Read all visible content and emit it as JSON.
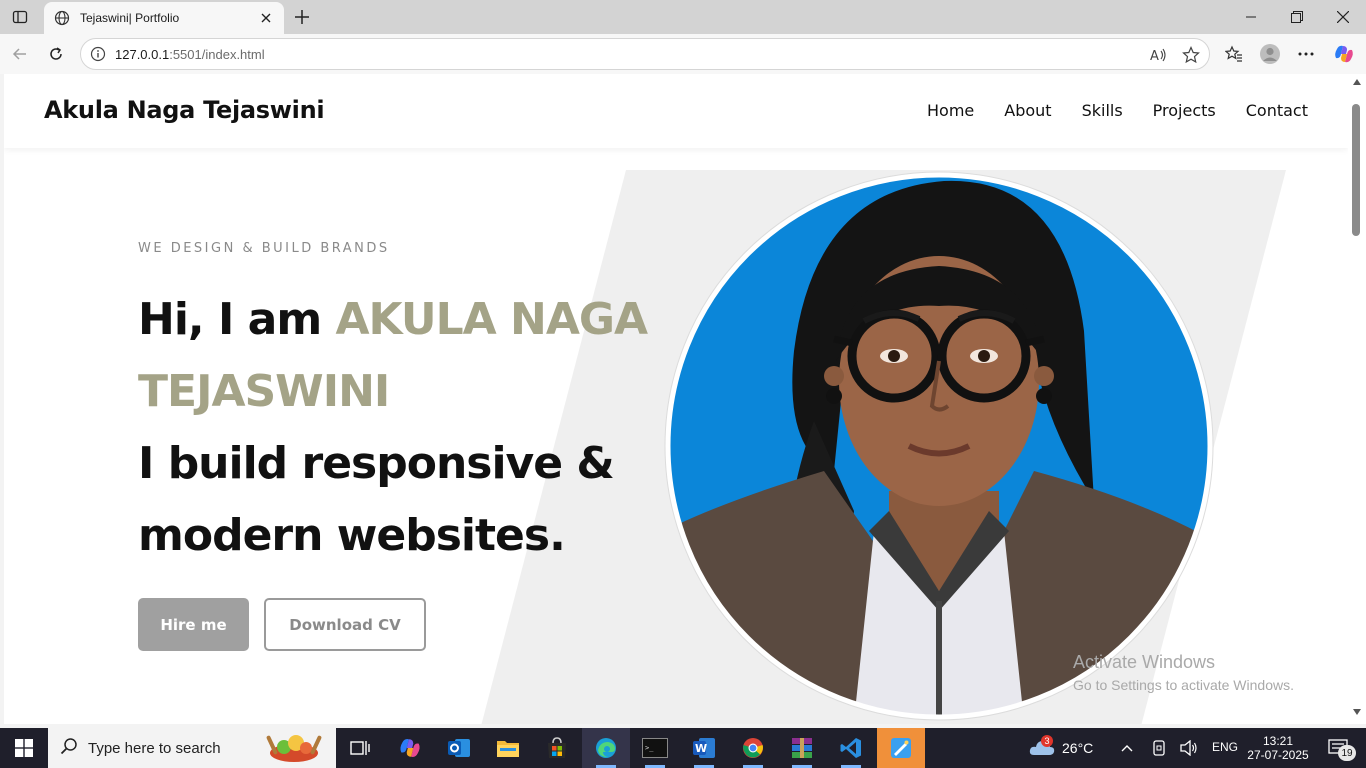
{
  "browser": {
    "tab_title": "Tejaswini| Portfolio",
    "url_host": "127.0.0.1",
    "url_rest": ":5501/index.html"
  },
  "site": {
    "brand": "Akula Naga Tejaswini",
    "nav": [
      "Home",
      "About",
      "Skills",
      "Projects",
      "Contact"
    ]
  },
  "hero": {
    "kicker": "WE DESIGN & BUILD BRANDS",
    "greeting": "Hi, I am ",
    "name": "AKULA NAGA TEJASWINI",
    "tagline": "I build responsive & modern websites.",
    "hire_label": "Hire me",
    "cv_label": "Download CV",
    "accent_color": "#a4a387"
  },
  "watermark": {
    "line1": "Activate Windows",
    "line2": "Go to Settings to activate Windows."
  },
  "taskbar": {
    "search_placeholder": "Type here to search",
    "weather_temp": "26°C",
    "weather_badge": "3",
    "language": "ENG",
    "time": "13:21",
    "date": "27-07-2025",
    "notification_count": "19"
  }
}
